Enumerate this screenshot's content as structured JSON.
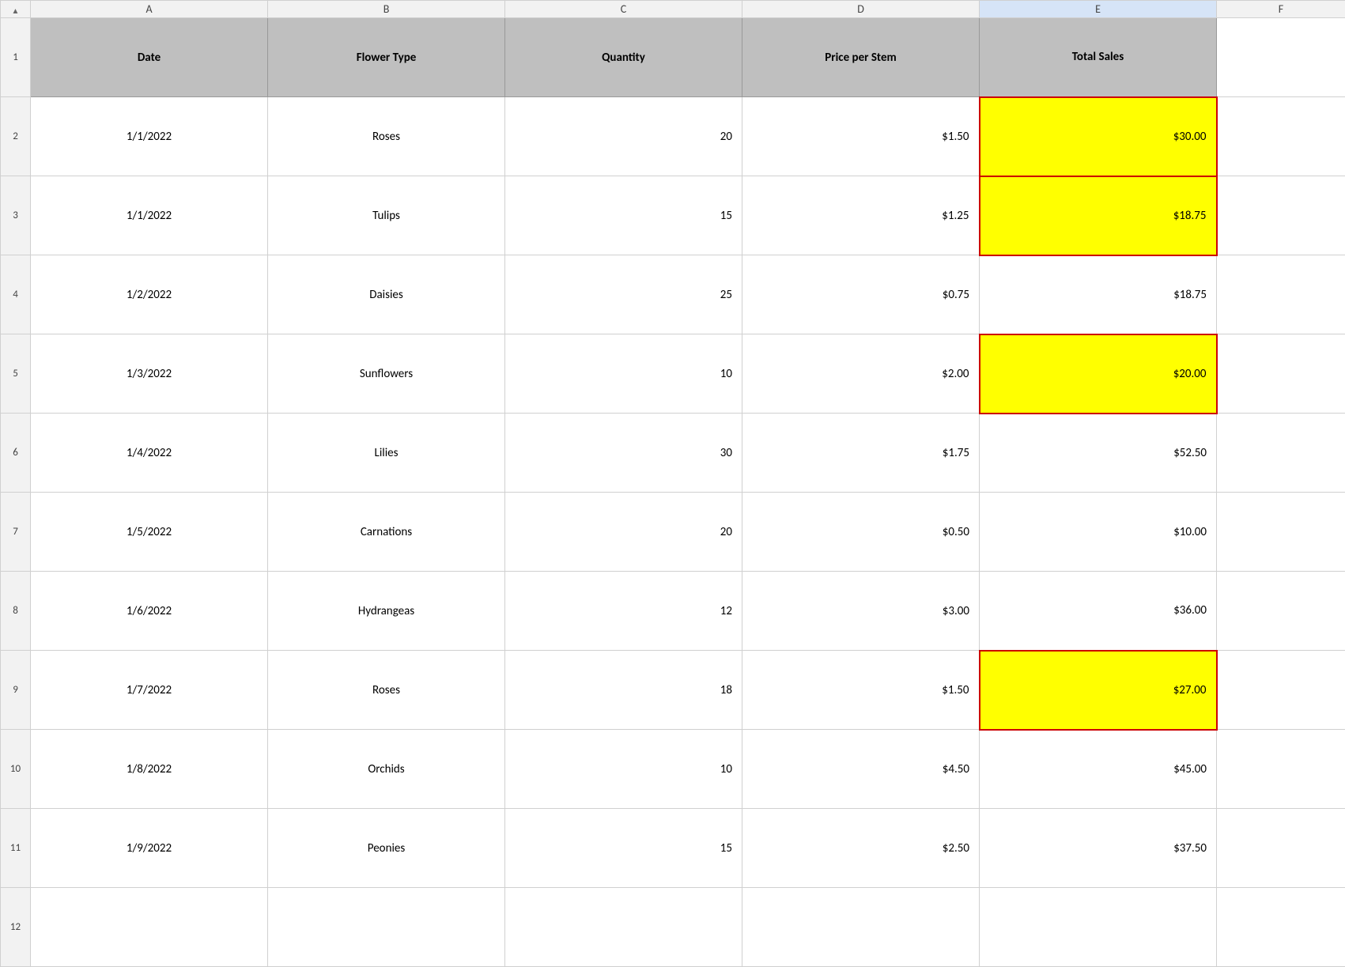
{
  "spreadsheet": {
    "columns": {
      "indicator": "",
      "a": "A",
      "b": "B",
      "c": "C",
      "d": "D",
      "e": "E",
      "f": "F"
    },
    "headers": {
      "a": "Date",
      "b": "Flower Type",
      "c": "Quantity",
      "d": "Price per Stem",
      "e": "Total Sales"
    },
    "rows": [
      {
        "num": "2",
        "a": "1/1/2022",
        "b": "Roses",
        "c": "20",
        "d": "$1.50",
        "e": "$30.00",
        "highlight": true
      },
      {
        "num": "3",
        "a": "1/1/2022",
        "b": "Tulips",
        "c": "15",
        "d": "$1.25",
        "e": "$18.75",
        "highlight": true
      },
      {
        "num": "4",
        "a": "1/2/2022",
        "b": "Daisies",
        "c": "25",
        "d": "$0.75",
        "e": "$18.75",
        "highlight": false
      },
      {
        "num": "5",
        "a": "1/3/2022",
        "b": "Sunflowers",
        "c": "10",
        "d": "$2.00",
        "e": "$20.00",
        "highlight": true
      },
      {
        "num": "6",
        "a": "1/4/2022",
        "b": "Lilies",
        "c": "30",
        "d": "$1.75",
        "e": "$52.50",
        "highlight": false
      },
      {
        "num": "7",
        "a": "1/5/2022",
        "b": "Carnations",
        "c": "20",
        "d": "$0.50",
        "e": "$10.00",
        "highlight": false
      },
      {
        "num": "8",
        "a": "1/6/2022",
        "b": "Hydrangeas",
        "c": "12",
        "d": "$3.00",
        "e": "$36.00",
        "highlight": false
      },
      {
        "num": "9",
        "a": "1/7/2022",
        "b": "Roses",
        "c": "18",
        "d": "$1.50",
        "e": "$27.00",
        "highlight": true
      },
      {
        "num": "10",
        "a": "1/8/2022",
        "b": "Orchids",
        "c": "10",
        "d": "$4.50",
        "e": "$45.00",
        "highlight": false
      },
      {
        "num": "11",
        "a": "1/9/2022",
        "b": "Peonies",
        "c": "15",
        "d": "$2.50",
        "e": "$37.50",
        "highlight": false
      }
    ],
    "empty_rows": [
      "12"
    ]
  }
}
